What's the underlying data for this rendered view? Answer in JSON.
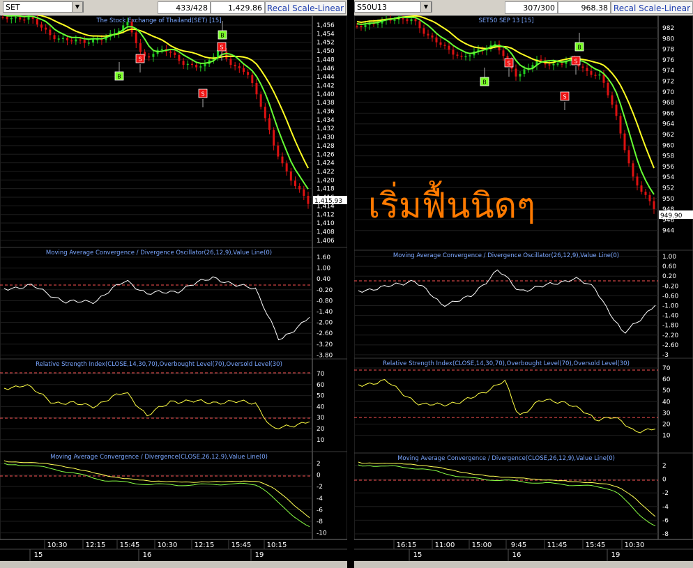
{
  "left": {
    "symbol": "SET",
    "counter": "433/428",
    "price": "1,429.86",
    "recal": "Recal Scale-Linear",
    "main_title": "The Stock Exchange of Thailand(SET) [15]",
    "last_price": "1,415.93",
    "price_ticks": [
      "1,456",
      "1,454",
      "1,452",
      "1,450",
      "1,448",
      "1,446",
      "1,444",
      "1,442",
      "1,440",
      "1,438",
      "1,436",
      "1,434",
      "1,432",
      "1,430",
      "1,428",
      "1,426",
      "1,424",
      "1,422",
      "1,420",
      "1,418",
      "1,416",
      "1,414",
      "1,412",
      "1,410",
      "1,408",
      "1,406"
    ],
    "osc_title": "Moving Average Convergence / Divergence Oscillator(26,12,9),Value Line(0)",
    "osc_ticks": [
      "1.60",
      "1.00",
      "0.40",
      "-0.20",
      "-0.80",
      "-1.40",
      "-2.00",
      "-2.60",
      "-3.20",
      "-3.80"
    ],
    "rsi_title": "Relative Strength Index(CLOSE,14,30,70),Overbought Level(70),Oversold Level(30)",
    "rsi_ticks": [
      "70",
      "60",
      "50",
      "40",
      "30",
      "20",
      "10"
    ],
    "macd_title": "Moving Average Convergence / Divergence(CLOSE,26,12,9),Value Line(0)",
    "macd_ticks": [
      "2",
      "0",
      "-2",
      "-4",
      "-6",
      "-8",
      "-10"
    ],
    "time_labels": [
      "10:30",
      "12:15",
      "15:45",
      "10:30",
      "12:15",
      "15:45",
      "10:15"
    ],
    "date_labels": [
      "15",
      "16",
      "19"
    ],
    "signals": [
      "B",
      "S",
      "S",
      "B",
      "S"
    ]
  },
  "right": {
    "symbol": "S50U13",
    "counter": "307/300",
    "price": "968.38",
    "recal": "Recal Scale-Linear",
    "main_title": "SET50 SEP 13   [15]",
    "last_price": "949.90",
    "price_ticks": [
      "982",
      "980",
      "978",
      "976",
      "974",
      "972",
      "970",
      "968",
      "966",
      "964",
      "962",
      "960",
      "958",
      "956",
      "954",
      "952",
      "950",
      "948",
      "946",
      "944"
    ],
    "osc_title": "Moving Average Convergence / Divergence Oscillator(26,12,9),Value Line(0)",
    "osc_ticks": [
      "1.00",
      "0.60",
      "0.20",
      "-0.20",
      "-0.60",
      "-1.00",
      "-1.40",
      "-1.80",
      "-2.20",
      "-2.60",
      "-3"
    ],
    "rsi_title": "Relative Strength Index(CLOSE,14,30,70),Overbought Level(70),Oversold Level(30)",
    "rsi_ticks": [
      "70",
      "60",
      "50",
      "40",
      "30",
      "20",
      "10"
    ],
    "macd_title": "Moving Average Convergence / Divergence(CLOSE,26,12,9),Value Line(0)",
    "macd_ticks": [
      "2",
      "0",
      "-2",
      "-4",
      "-6",
      "-8"
    ],
    "time_labels": [
      "16:15",
      "11:00",
      "15:00",
      "9:45",
      "11:45",
      "15:45",
      "10:30"
    ],
    "date_labels": [
      "15",
      "16",
      "19"
    ],
    "signals": [
      "B",
      "S",
      "S",
      "B",
      "S"
    ]
  },
  "annotation": "เริ่มฟื้นนิดๆ",
  "colors": {
    "up": "#22cc22",
    "down": "#dd1111",
    "ma_fast": "#66ff33",
    "ma_slow": "#ffff22",
    "grid": "#1e1e1e",
    "title": "#7aa6ff",
    "axis_text": "#ffffff",
    "signal_buy": "#7bff2a",
    "signal_sell": "#ee1111",
    "annotation": "#ff7a00"
  }
}
